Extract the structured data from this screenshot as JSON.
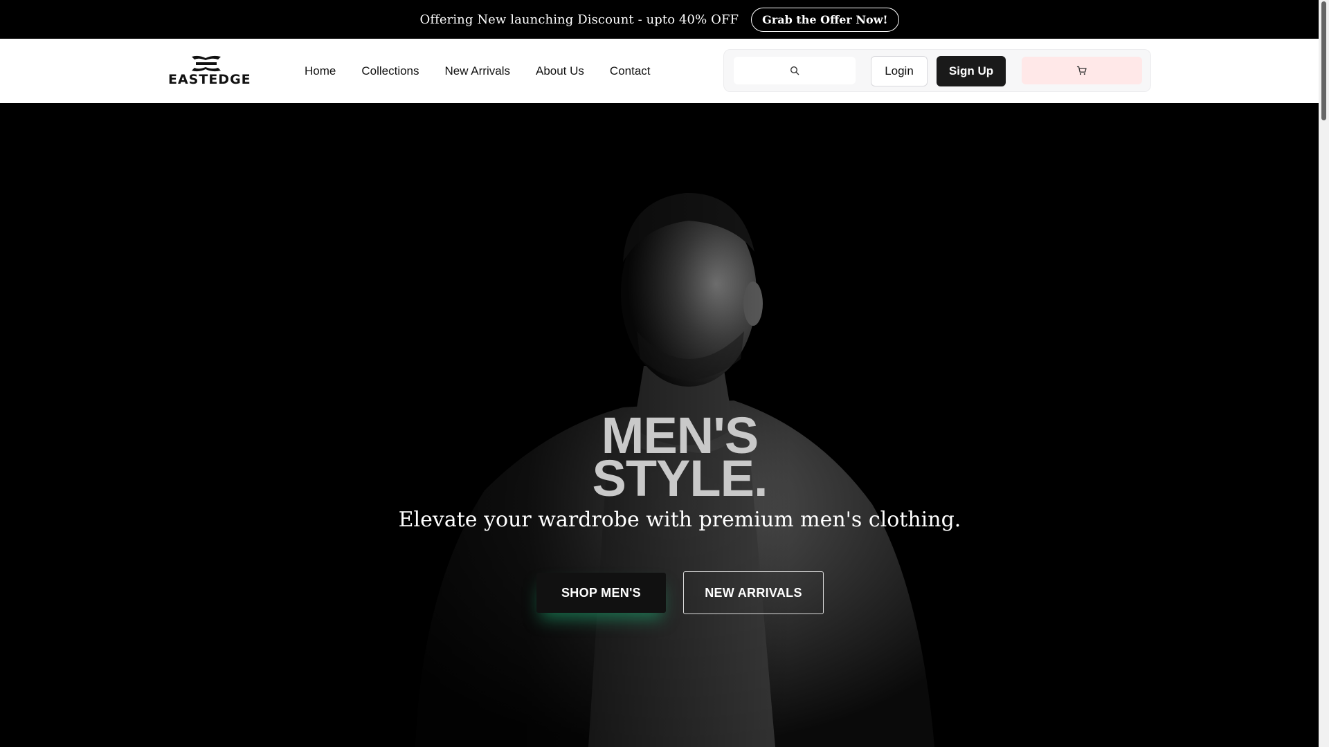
{
  "announcement": {
    "text": "Offering New launching Discount - upto 40% OFF",
    "cta": "Grab the Offer Now!"
  },
  "brand": {
    "name": "EASTEDGE"
  },
  "nav": {
    "items": [
      {
        "label": "Home"
      },
      {
        "label": "Collections"
      },
      {
        "label": "New Arrivals"
      },
      {
        "label": "About Us"
      },
      {
        "label": "Contact"
      }
    ]
  },
  "actions": {
    "search_placeholder": "",
    "login_label": "Login",
    "signup_label": "Sign Up"
  },
  "hero": {
    "headline_line1": "MEN'S",
    "headline_line2": "STYLE.",
    "subheadline": "Elevate your wardrobe with premium men's clothing.",
    "primary_cta": "SHOP MEN'S",
    "secondary_cta": "NEW ARRIVALS"
  },
  "icons": {
    "search": "search-icon",
    "cart": "cart-icon",
    "logo": "logo-icon"
  },
  "colors": {
    "announcement_bg": "#000000",
    "header_bg": "#ffffff",
    "signup_bg": "#1a1a1a",
    "cart_bg": "#ffe8e8",
    "hero_bg": "#000000",
    "headline": "#c9c9c9",
    "cta_glow": "#1eb478"
  }
}
